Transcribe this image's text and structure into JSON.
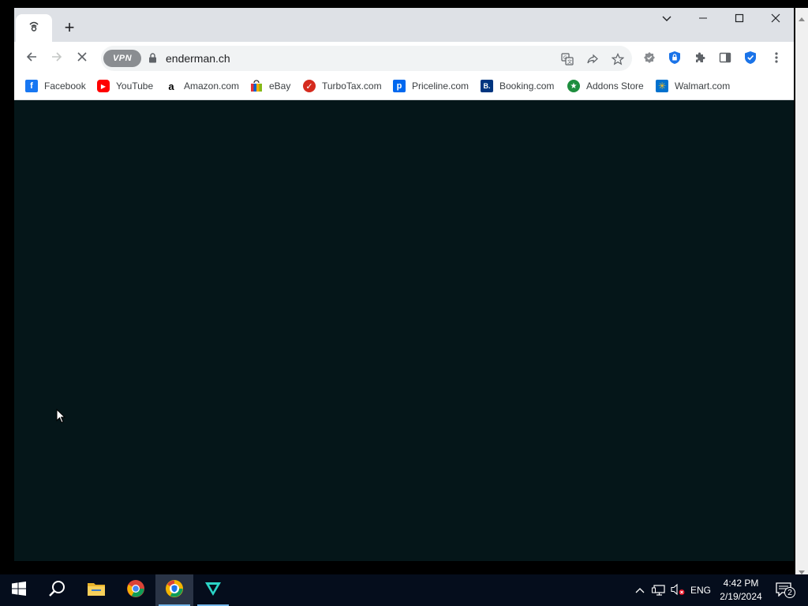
{
  "browser": {
    "tab": {
      "title": ""
    },
    "new_tab_label": "+",
    "toolbar": {
      "vpn_label": "VPN",
      "url": "enderman.ch"
    },
    "bookmarks": [
      {
        "label": "Facebook",
        "icon": "facebook-icon",
        "color": "#1877f2",
        "glyph": "f"
      },
      {
        "label": "YouTube",
        "icon": "youtube-icon",
        "color": "#ff0000",
        "glyph": "▶"
      },
      {
        "label": "Amazon.com",
        "icon": "amazon-icon",
        "color": "#ffffff",
        "glyph": "a"
      },
      {
        "label": "eBay",
        "icon": "ebay-icon",
        "color": "#f5af02",
        "glyph": ""
      },
      {
        "label": "TurboTax.com",
        "icon": "turbotax-icon",
        "color": "#d52b1e",
        "glyph": "✓"
      },
      {
        "label": "Priceline.com",
        "icon": "priceline-icon",
        "color": "#0068ef",
        "glyph": "p"
      },
      {
        "label": "Booking.com",
        "icon": "booking-icon",
        "color": "#003580",
        "glyph": "B."
      },
      {
        "label": "Addons Store",
        "icon": "addons-store-icon",
        "color": "#1e8e3e",
        "glyph": "★"
      },
      {
        "label": "Walmart.com",
        "icon": "walmart-icon",
        "color": "#0071ce",
        "glyph": "✳"
      }
    ]
  },
  "taskbar": {
    "items": [
      {
        "name": "start-button",
        "icon": "windows-icon"
      },
      {
        "name": "search-button",
        "icon": "search-icon"
      },
      {
        "name": "file-explorer-button",
        "icon": "folder-icon"
      },
      {
        "name": "chrome-button",
        "icon": "chrome-icon"
      },
      {
        "name": "secure-browser-button",
        "icon": "shield-browser-icon",
        "active": true
      },
      {
        "name": "vpn-app-button",
        "icon": "vpn-app-icon"
      }
    ],
    "tray": {
      "language": "ENG",
      "time": "4:42 PM",
      "date": "2/19/2024",
      "notification_count": "2"
    }
  },
  "colors": {
    "content_bg": "#051619",
    "taskbar_bg": "#050d1c",
    "accent": "#1a73e8"
  }
}
